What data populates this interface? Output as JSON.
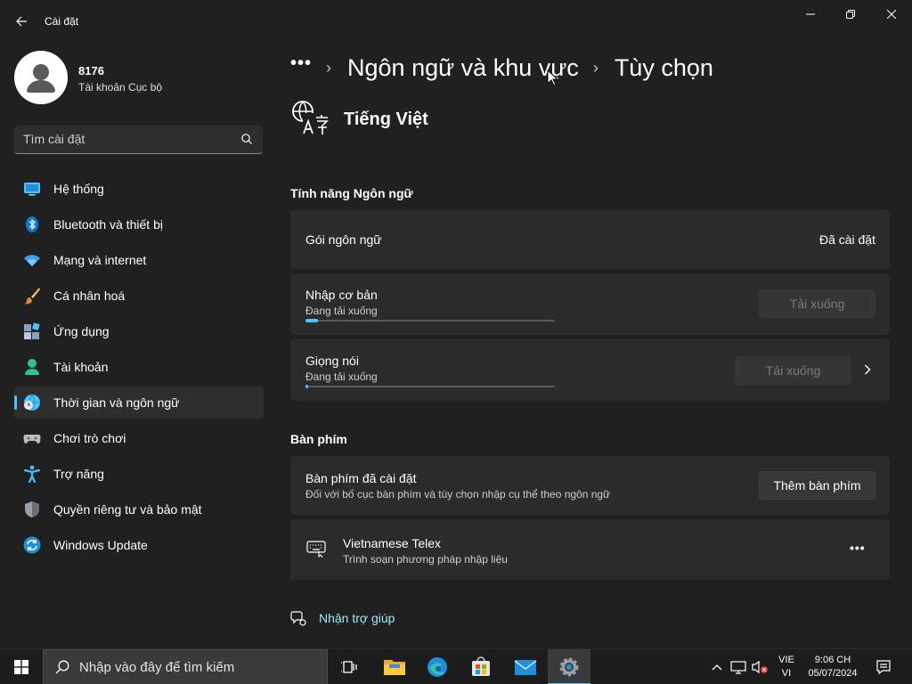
{
  "app": {
    "title": "Cài đặt"
  },
  "profile": {
    "name": "8176",
    "account_type": "Tài khoản Cục bộ"
  },
  "search": {
    "placeholder": "Tìm cài đặt"
  },
  "sidebar": {
    "items": [
      {
        "label": "Hệ thống",
        "icon": "monitor-icon"
      },
      {
        "label": "Bluetooth và thiết bị",
        "icon": "bluetooth-icon"
      },
      {
        "label": "Mạng và internet",
        "icon": "wifi-icon"
      },
      {
        "label": "Cá nhân hoá",
        "icon": "paintbrush-icon"
      },
      {
        "label": "Ứng dụng",
        "icon": "apps-icon"
      },
      {
        "label": "Tài khoản",
        "icon": "account-icon"
      },
      {
        "label": "Thời gian và ngôn ngữ",
        "icon": "globe-clock-icon",
        "active": true
      },
      {
        "label": "Chơi trò chơi",
        "icon": "gamepad-icon"
      },
      {
        "label": "Trợ năng",
        "icon": "accessibility-icon"
      },
      {
        "label": "Quyền riêng tư và bảo mật",
        "icon": "shield-icon"
      },
      {
        "label": "Windows Update",
        "icon": "update-icon"
      }
    ]
  },
  "breadcrumb": {
    "more": "•••",
    "parent": "Ngôn ngữ và khu vực",
    "current": "Tùy chọn"
  },
  "page": {
    "title": "Tiếng Việt"
  },
  "language_features": {
    "heading": "Tính năng Ngôn ngữ",
    "language_pack": {
      "title": "Gói ngôn ngữ",
      "status": "Đã cài đặt"
    },
    "basic_typing": {
      "title": "Nhập cơ bản",
      "status": "Đang tải xuống",
      "progress": 0.05,
      "button": "Tải xuống"
    },
    "speech": {
      "title": "Giọng nói",
      "status": "Đang tải xuống",
      "progress": 0.01,
      "button": "Tải xuống"
    }
  },
  "keyboard": {
    "heading": "Bàn phím",
    "installed": {
      "title": "Bàn phím đã cài đặt",
      "description": "Đối với bố cục bàn phím và tùy chọn nhập cụ thể theo ngôn ngữ",
      "button": "Thêm bàn phím"
    },
    "item": {
      "title": "Vietnamese Telex",
      "subtitle": "Trình soạn phương pháp nhập liệu",
      "more": "•••"
    }
  },
  "help": {
    "label": "Nhận trợ giúp"
  },
  "taskbar": {
    "search_placeholder": "Nhập vào đây để tìm kiếm",
    "lang_line1": "VIE",
    "lang_line2": "VI",
    "time": "9:06 CH",
    "date": "05/07/2024"
  },
  "colors": {
    "accent": "#4cc2ff",
    "background": "#202020",
    "card": "#2b2b2b",
    "link": "#99ebff"
  }
}
